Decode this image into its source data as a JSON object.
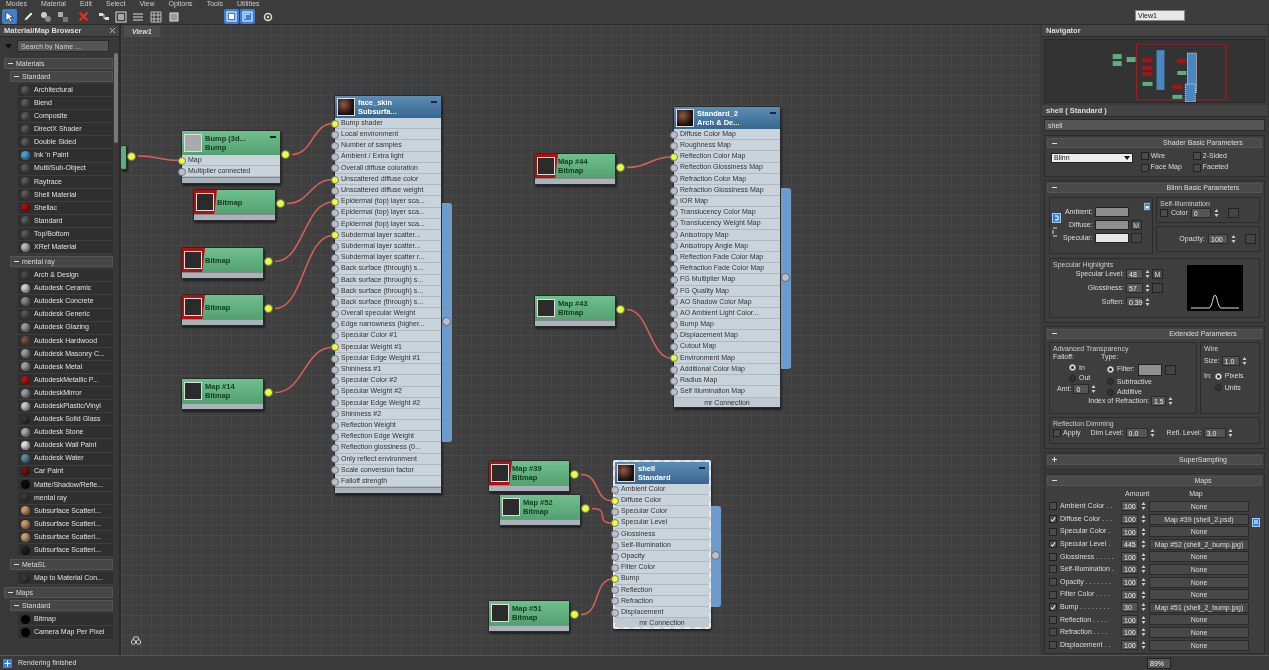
{
  "menu": [
    "Modes",
    "Material",
    "Edit",
    "Select",
    "View",
    "Options",
    "Tools",
    "Utilities"
  ],
  "toolbar": [
    {
      "selected": true
    },
    {
      "selected": false
    },
    {
      "selected": false
    },
    {
      "selected": false
    },
    {
      "selected": false
    },
    {
      "selected": false
    },
    {
      "selected": false
    },
    {
      "selected": false
    },
    {
      "selected": false
    },
    {
      "selected": false
    },
    {
      "selected": true
    },
    {
      "selected": true
    },
    {
      "selected": false
    }
  ],
  "view_selector": "View1",
  "browser": {
    "title": "Material/Map Browser",
    "search": {
      "placeholder": "Search by Name ..."
    },
    "sections": [
      {
        "label": "Materials",
        "expanded": true,
        "groups": [
          {
            "label": "Standard",
            "expanded": true,
            "items": [
              {
                "label": "Architectural",
                "color": "#5a5a5a"
              },
              {
                "label": "Blend",
                "color": "#5a5a5a"
              },
              {
                "label": "Composite",
                "color": "#5a5a5a"
              },
              {
                "label": "DirectX Shader",
                "color": "#5a5a5a"
              },
              {
                "label": "Double Sided",
                "color": "#5a5a5a"
              },
              {
                "label": "Ink 'n Paint",
                "color": "#4a9fd6"
              },
              {
                "label": "Multi/Sub-Object",
                "color": "#5a5a5a"
              },
              {
                "label": "Raytrace",
                "color": "#5a5a5a"
              },
              {
                "label": "Shell Material",
                "color": "#5a5a5a"
              },
              {
                "label": "Shellac",
                "color": "#a51010"
              },
              {
                "label": "Standard",
                "color": "#5a5a5a"
              },
              {
                "label": "Top/Bottom",
                "color": "#5a5a5a"
              },
              {
                "label": "XRef Material",
                "color": "#bbbbbb"
              }
            ]
          },
          {
            "label": "mental ray",
            "expanded": true,
            "items": [
              {
                "label": "Arch & Design",
                "color": "#4a4a4a"
              },
              {
                "label": "Autodesk Ceramic",
                "color": "#cfcfcf"
              },
              {
                "label": "Autodesk Concrete",
                "color": "#8a8a8a"
              },
              {
                "label": "Autodesk Generic",
                "color": "#555555"
              },
              {
                "label": "Autodesk Glazing",
                "color": "#9a9a9a"
              },
              {
                "label": "Autodesk Hardwood",
                "color": "#7a5040"
              },
              {
                "label": "Autodesk Masonry C...",
                "color": "#9a9a9a"
              },
              {
                "label": "Autodesk Metal",
                "color": "#a0a0a0"
              },
              {
                "label": "AutodeskMetallic P...",
                "color": "#b01515"
              },
              {
                "label": "AutodeskMirror",
                "color": "#9a9a9a"
              },
              {
                "label": "AutodeskPlastic/Vinyl",
                "color": "#c8c8c8"
              },
              {
                "label": "Autodesk Solid Glass",
                "color": "#333333"
              },
              {
                "label": "Autodesk Stone",
                "color": "#a8a8a8"
              },
              {
                "label": "Autodesk Wall Paint",
                "color": "#dcdcdc"
              },
              {
                "label": "Autodesk Water",
                "color": "#5c8c9a"
              },
              {
                "label": "Car Paint",
                "color": "#701010"
              },
              {
                "label": "Matte/Shadow/Refle...",
                "color": "#0a0a0a"
              },
              {
                "label": "mental ray",
                "color": "#3a3a3a"
              },
              {
                "label": "Subsurface Scatteri...",
                "color": "#c89a6a"
              },
              {
                "label": "Subsurface Scatteri...",
                "color": "#c89a6a"
              },
              {
                "label": "Subsurface Scatteri...",
                "color": "#c8a070"
              },
              {
                "label": "Subsurface Scatteri...",
                "color": "#1e1e1e"
              }
            ]
          },
          {
            "label": "MetaSL",
            "expanded": true,
            "items": [
              {
                "label": "Map to Material Con...",
                "color": "#3a3a3a"
              }
            ]
          }
        ]
      },
      {
        "label": "Maps",
        "expanded": true,
        "groups": [
          {
            "label": "Standard",
            "expanded": true,
            "items": [
              {
                "label": "Bitmap",
                "color": "#000000"
              },
              {
                "label": "Camera Map Per Pixel",
                "color": "#000000"
              }
            ]
          }
        ]
      }
    ]
  },
  "view": {
    "tab": "View1",
    "nodes": [
      {
        "kind": "stub",
        "selected": false
      },
      {
        "kind": "bump",
        "selected": false,
        "title": "Bump (3d...",
        "subtitle": "Bump",
        "slots": [
          {
            "label": "Map",
            "connected": true
          },
          {
            "label": "Multiplier connected",
            "connected": false
          }
        ]
      },
      {
        "kind": "material",
        "selected": false,
        "title": "face_skin",
        "subtitle": "Subsurfa...",
        "slots": [
          {
            "label": "Bump shader",
            "connected": true
          },
          {
            "label": "Local environment",
            "connected": false
          },
          {
            "label": "Number of samples",
            "connected": false
          },
          {
            "label": "Ambient / Extra light",
            "connected": false
          },
          {
            "label": "Overall diffuse coloration",
            "connected": false
          },
          {
            "label": "Unscattered diffuse color",
            "connected": true
          },
          {
            "label": "Unscattered diffuse weight",
            "connected": false
          },
          {
            "label": "Epidermal (top) layer sca...",
            "connected": true
          },
          {
            "label": "Epidermal (top) layer sca...",
            "connected": false
          },
          {
            "label": "Epidermal (top) layer sca...",
            "connected": false
          },
          {
            "label": "Subdermal layer scatter...",
            "connected": true
          },
          {
            "label": "Subdermal layer scatter...",
            "connected": false
          },
          {
            "label": "Subdermal layer scatter r...",
            "connected": false
          },
          {
            "label": "Back surface (through) s...",
            "connected": false
          },
          {
            "label": "Back surface (through) s...",
            "connected": false
          },
          {
            "label": "Back surface (through) s...",
            "connected": false
          },
          {
            "label": "Back surface (through) s...",
            "connected": false
          },
          {
            "label": "Overall specular Weight",
            "connected": false
          },
          {
            "label": "Edge narrowness (higher...",
            "connected": false
          },
          {
            "label": "Specular Color #1",
            "connected": false
          },
          {
            "label": "Specular Weight #1",
            "connected": true
          },
          {
            "label": "Specular Edge Weight #1",
            "connected": false
          },
          {
            "label": "Shininess #1",
            "connected": false
          },
          {
            "label": "Specular Color #2",
            "connected": false
          },
          {
            "label": "Specular Weight #2",
            "connected": false
          },
          {
            "label": "Specular Edge Weight #2",
            "connected": false
          },
          {
            "label": "Shininess #2",
            "connected": false
          },
          {
            "label": "Reflection Weight",
            "connected": false
          },
          {
            "label": "Reflection Edge Weight",
            "connected": false
          },
          {
            "label": "Reflection glossiness (0...",
            "connected": false
          },
          {
            "label": "Only reflect environment",
            "connected": false
          },
          {
            "label": "Scale conversion factor",
            "connected": false
          },
          {
            "label": "Falloff strength",
            "connected": false
          }
        ]
      },
      {
        "kind": "map",
        "selected": false,
        "flagged": true,
        "subtitle": "Bitmap"
      },
      {
        "kind": "map",
        "selected": false,
        "flagged": true,
        "subtitle": "Bitmap"
      },
      {
        "kind": "map",
        "selected": false,
        "flagged": true,
        "subtitle": "Bitmap"
      },
      {
        "kind": "map",
        "selected": false,
        "flagged": false,
        "title": "Map #14",
        "subtitle": "Bitmap"
      },
      {
        "kind": "map",
        "selected": false,
        "flagged": true,
        "title": "Map #44",
        "subtitle": "Bitmap"
      },
      {
        "kind": "material",
        "selected": false,
        "title": "Standard_2",
        "subtitle": "Arch & De...",
        "footer": "mr Connection",
        "slots": [
          {
            "label": "Diffuse Color Map",
            "connected": false
          },
          {
            "label": "Roughness Map",
            "connected": false
          },
          {
            "label": "Reflection Color Map",
            "connected": true
          },
          {
            "label": "Reflection Glossiness Map",
            "connected": false
          },
          {
            "label": "Refraction Color Map",
            "connected": false
          },
          {
            "label": "Refraction Glossiness Map",
            "connected": false
          },
          {
            "label": "IOR Map",
            "connected": false
          },
          {
            "label": "Translucency Color Map",
            "connected": false
          },
          {
            "label": "Translucency Weight Map",
            "connected": false
          },
          {
            "label": "Anisotropy Map",
            "connected": false
          },
          {
            "label": "Anisotropy Angle Map",
            "connected": false
          },
          {
            "label": "Reflection Fade Color Map",
            "connected": false
          },
          {
            "label": "Refraction Fade Color Map",
            "connected": false
          },
          {
            "label": "FG Multiplier Map",
            "connected": false
          },
          {
            "label": "FG Quality Map",
            "connected": false
          },
          {
            "label": "AO Shadow Color Map",
            "connected": false
          },
          {
            "label": "AO Ambient Light Color...",
            "connected": false
          },
          {
            "label": "Bump Map",
            "connected": false
          },
          {
            "label": "Displacement Map",
            "connected": false
          },
          {
            "label": "Cutout Map",
            "connected": false
          },
          {
            "label": "Environment Map",
            "connected": true
          },
          {
            "label": "Additional Color Map",
            "connected": false
          },
          {
            "label": "Radius Map",
            "connected": false
          },
          {
            "label": "Self Illumination Map",
            "connected": false
          }
        ]
      },
      {
        "kind": "map",
        "selected": false,
        "flagged": false,
        "title": "Map #43",
        "subtitle": "Bitmap"
      },
      {
        "kind": "map",
        "selected": false,
        "flagged": true,
        "title": "Map #39",
        "subtitle": "Bitmap"
      },
      {
        "kind": "map",
        "selected": false,
        "flagged": false,
        "title": "Map #52",
        "subtitle": "Bitmap"
      },
      {
        "kind": "map",
        "selected": false,
        "flagged": false,
        "title": "Map #51",
        "subtitle": "Bitmap"
      },
      {
        "kind": "material",
        "selected": true,
        "title": "shell",
        "subtitle": "Standard",
        "footer": "mr Connection",
        "slots": [
          {
            "label": "Ambient Color",
            "connected": false
          },
          {
            "label": "Diffuse Color",
            "connected": true
          },
          {
            "label": "Specular Color",
            "connected": false
          },
          {
            "label": "Specular Level",
            "connected": true
          },
          {
            "label": "Glossiness",
            "connected": false
          },
          {
            "label": "Self-Illumination",
            "connected": false
          },
          {
            "label": "Opacity",
            "connected": false
          },
          {
            "label": "Filter Color",
            "connected": false
          },
          {
            "label": "Bump",
            "connected": true
          },
          {
            "label": "Reflection",
            "connected": false
          },
          {
            "label": "Refraction",
            "connected": false
          },
          {
            "label": "Displacement",
            "connected": false
          }
        ]
      }
    ]
  },
  "navigator": {
    "title": "Navigator"
  },
  "properties": {
    "title": "shell  ( Standard )",
    "name": "shell",
    "shader": {
      "title": "Shader Basic Parameters",
      "expanded": true,
      "shader": "Blinn",
      "options": [
        {
          "label": "Wire",
          "checked": false
        },
        {
          "label": "2-Sided",
          "checked": false
        },
        {
          "label": "Face Map",
          "checked": false
        },
        {
          "label": "Faceted",
          "checked": false
        }
      ]
    },
    "blinn": {
      "title": "Blinn Basic Parameters",
      "expanded": true,
      "colors": [
        {
          "label": "Ambient:",
          "color": "#8e8e8e"
        },
        {
          "label": "Diffuse:",
          "color": "#8e8e8e"
        },
        {
          "label": "Specular:",
          "color": "#e6e6e6"
        }
      ],
      "map_button": "M",
      "self_illum": {
        "title": "Self-Illumination",
        "label": "Color",
        "checked": false,
        "value": "0"
      },
      "opacity": {
        "label": "Opacity:",
        "value": "100"
      },
      "highlights": {
        "title": "Specular Highlights",
        "fields": [
          {
            "label": "Specular Level:",
            "value": "48",
            "map_button": "M"
          },
          {
            "label": "Glossiness:",
            "value": "57"
          },
          {
            "label": "Soften:",
            "value": "0.39"
          }
        ]
      }
    },
    "extended": {
      "title": "Extended Parameters",
      "expanded": true,
      "transparency_title": "Advanced Transparency",
      "falloff_label": "Falloff:",
      "falloff": [
        {
          "label": "In",
          "selected": true
        },
        {
          "label": "Out",
          "selected": false
        }
      ],
      "type_label": "Type:",
      "types": [
        {
          "label": "Filter:",
          "selected": true
        },
        {
          "label": "Subtractive",
          "selected": false
        },
        {
          "label": "Additive",
          "selected": false
        }
      ],
      "amt_label": "Amt:",
      "amt": "0",
      "ior_label": "Index of Refraction:",
      "ior": "1.5",
      "wire_title": "Wire",
      "size_label": "Size:",
      "size": "1.0",
      "in_label": "In:",
      "units": [
        {
          "label": "Pixels",
          "selected": true
        },
        {
          "label": "Units",
          "selected": false
        }
      ],
      "dimming_title": "Reflection Dimming",
      "apply": {
        "label": "Apply",
        "checked": false
      },
      "dim_label": "Dim Level:",
      "dim": "0.0",
      "refl_label": "Refl. Level:",
      "refl": "3.0"
    },
    "supersampling": {
      "title": "SuperSampling",
      "expanded": false
    },
    "maps": {
      "title": "Maps",
      "expanded": true,
      "amount_header": "Amount",
      "map_header": "Map",
      "rows": [
        {
          "label": "Ambient Color . .",
          "checked": false,
          "amount": "100",
          "map": "None"
        },
        {
          "label": "Diffuse Color . . .",
          "checked": true,
          "amount": "100",
          "map": "Map #39 (shell_2.psd)"
        },
        {
          "label": "Specular Color .",
          "checked": false,
          "amount": "100",
          "map": "None"
        },
        {
          "label": "Specular Level .",
          "checked": true,
          "amount": "445",
          "map": "Map #52 (shell_2_bump.jpg)"
        },
        {
          "label": "Glossiness . . . . .",
          "checked": false,
          "amount": "100",
          "map": "None"
        },
        {
          "label": "Self-Illumination .",
          "checked": false,
          "amount": "100",
          "map": "None"
        },
        {
          "label": "Opacity . . . . . . .",
          "checked": false,
          "amount": "100",
          "map": "None"
        },
        {
          "label": "Filter Color . . . .",
          "checked": false,
          "amount": "100",
          "map": "None"
        },
        {
          "label": "Bump . . . . . . . .",
          "checked": true,
          "amount": "30",
          "map": "Map #51 (shell_2_bump.jpg)"
        },
        {
          "label": "Reflection . . . .",
          "checked": false,
          "amount": "100",
          "map": "None"
        },
        {
          "label": "Refraction . . . .",
          "checked": false,
          "amount": "100",
          "map": "None"
        },
        {
          "label": "Displacement . .",
          "checked": false,
          "amount": "100",
          "map": "None"
        }
      ]
    }
  },
  "status": {
    "message": "Rendering finished",
    "zoom": "89%"
  }
}
